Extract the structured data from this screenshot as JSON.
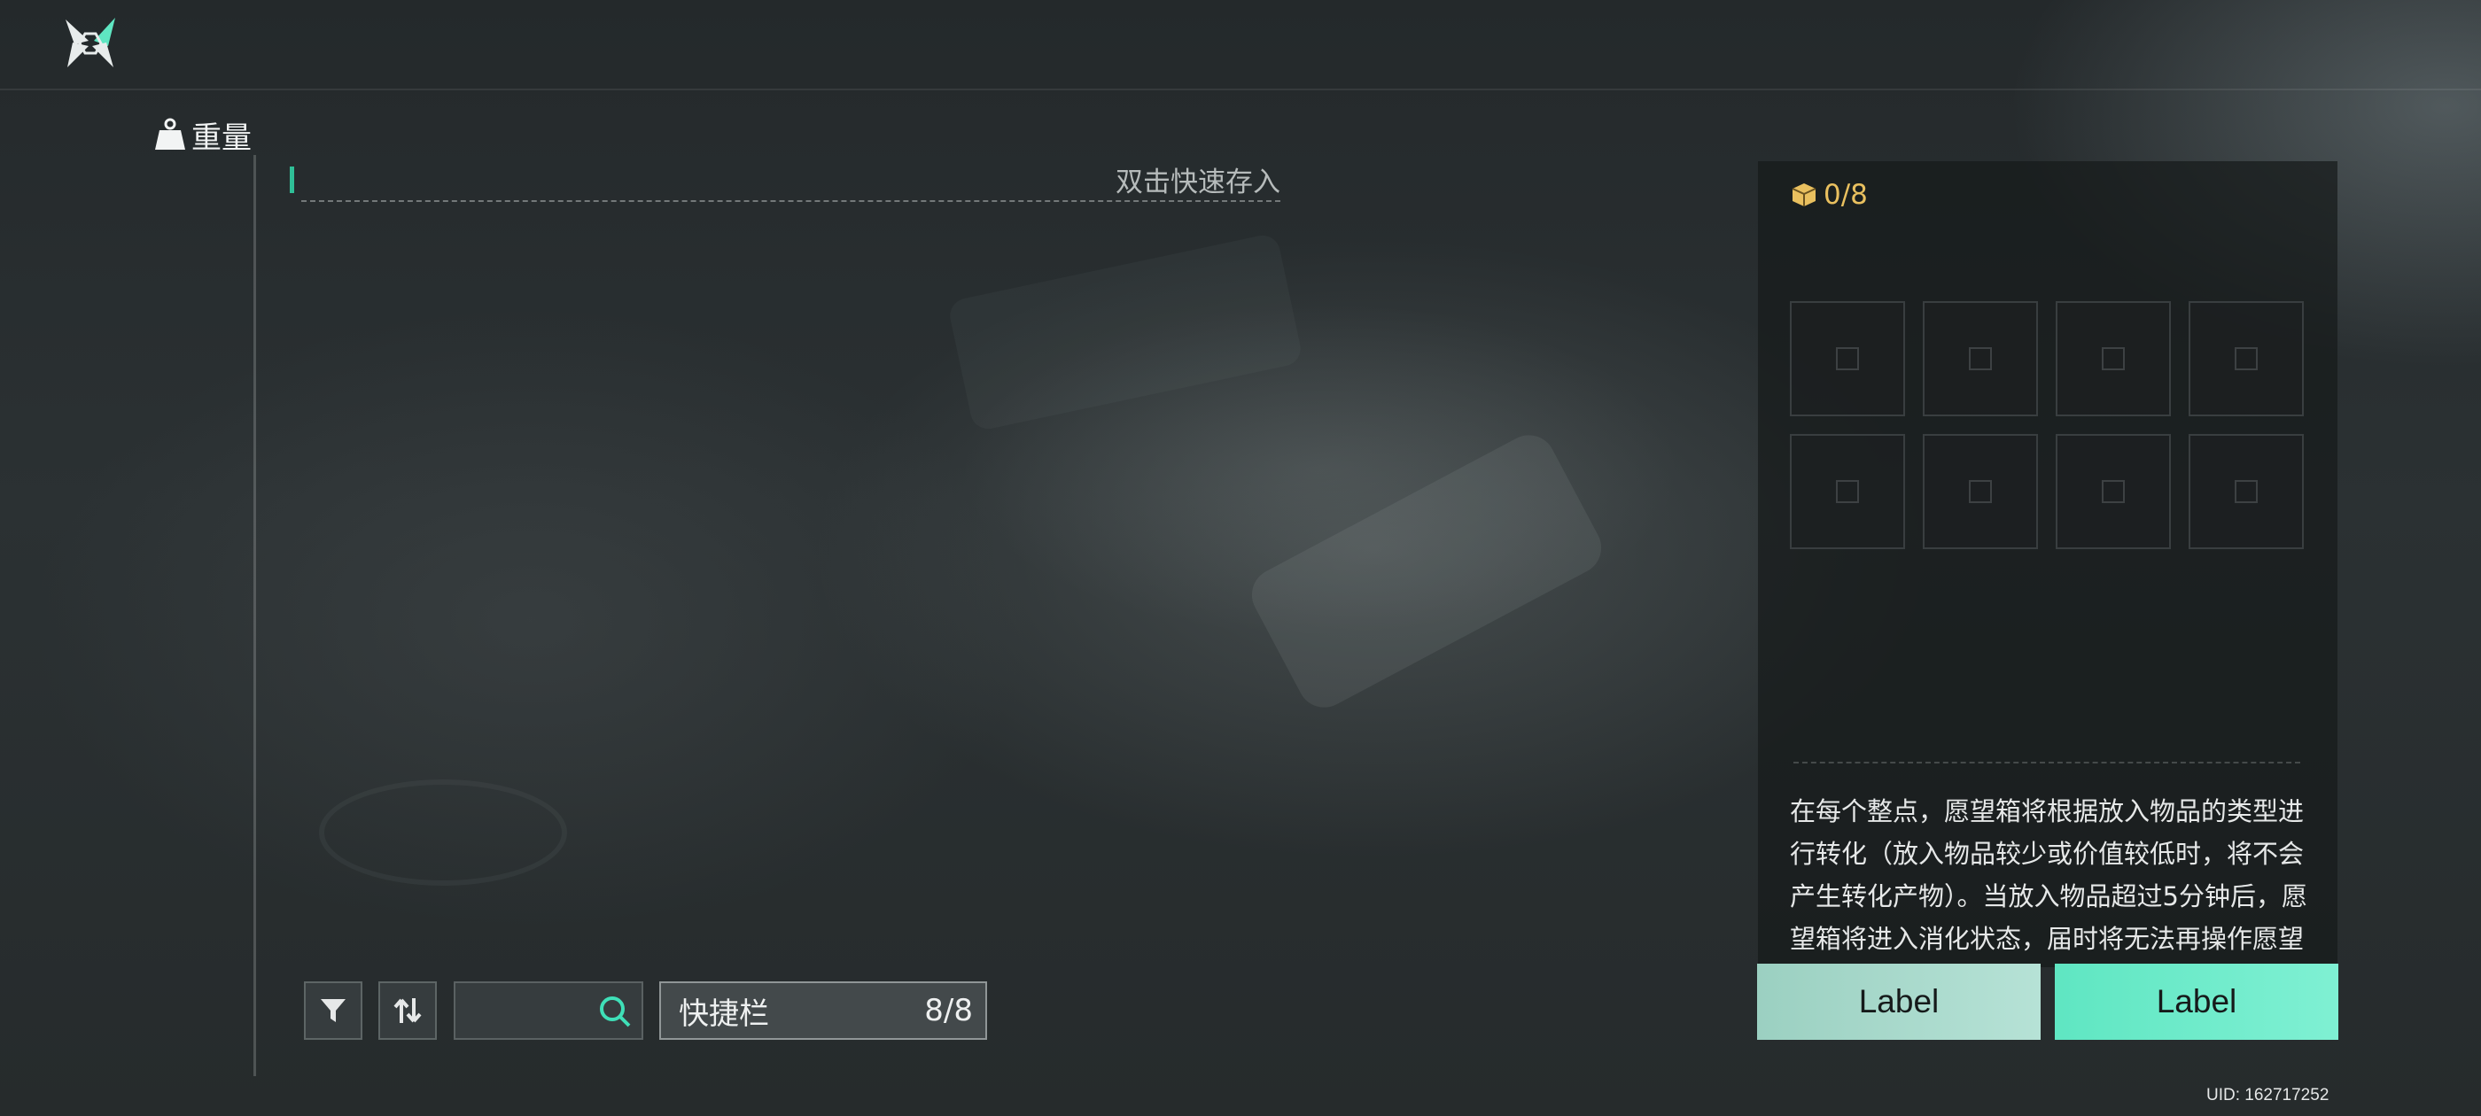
{
  "weight": {
    "label": "重量",
    "icon": "weight-icon"
  },
  "deposit": {
    "hint": "双击快速存入"
  },
  "toolbar": {
    "filter_icon": "filter-icon",
    "sort_icon": "sort-icon",
    "search": {
      "value": "",
      "placeholder": "",
      "icon": "search-icon"
    },
    "quickbar": {
      "label": "快捷栏",
      "count": "8/8"
    }
  },
  "wish_box": {
    "capacity": "0/8",
    "icon": "box-icon",
    "slots": 8,
    "description": "在每个整点，愿望箱将根据放入物品的类型进行转化（放入物品较少或价值较低时，将不会产生转化产物）。当放入物品超过5分钟后，愿望箱将进入消化状态，届时将无法再操作愿望箱。"
  },
  "buttons": {
    "left_label": "Label",
    "right_label": "Label"
  },
  "uid": "UID: 162717252",
  "colors": {
    "accent": "#5fe6c2",
    "count_color": "#e9c05f",
    "marker": "#2fbf97"
  }
}
